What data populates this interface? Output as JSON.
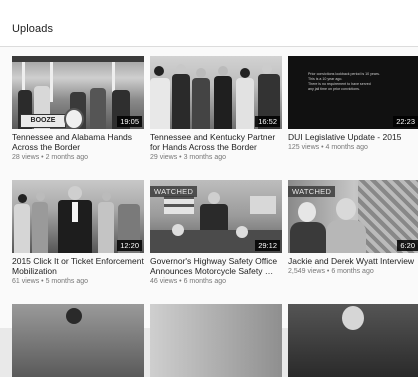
{
  "header": {
    "title": "Uploads"
  },
  "videos": [
    {
      "title": "Tennessee and Alabama Hands Across the Border",
      "views": "28 views",
      "age": "2 months ago",
      "duration": "19:05",
      "watched": ""
    },
    {
      "title": "Tennessee and Kentucky Partner for Hands Across the Border",
      "views": "29 views",
      "age": "3 months ago",
      "duration": "16:52",
      "watched": ""
    },
    {
      "title": "DUI Legislative Update - 2015",
      "views": "125 views",
      "age": "4 months ago",
      "duration": "22:23",
      "watched": ""
    },
    {
      "title": "2015 Click It or Ticket Enforcement Mobilization",
      "views": "61 views",
      "age": "5 months ago",
      "duration": "12:20",
      "watched": ""
    },
    {
      "title": "Governor's Highway Safety Office Announces Motorcycle Safety …",
      "views": "46 views",
      "age": "6 months ago",
      "duration": "29:12",
      "watched": "WATCHED"
    },
    {
      "title": "Jackie and Derek Wyatt Interview",
      "views": "2,549 views",
      "age": "6 months ago",
      "duration": "6:20",
      "watched": "WATCHED"
    }
  ],
  "thumb_text": {
    "sign": "BOOZE",
    "slide_lines": [
      "Prior convictions lookback period is 10 years.",
      "This is a 10 year ago.",
      "There is no requirement to have served",
      "any jail time on prior convictions."
    ]
  },
  "meta_separator": " • "
}
